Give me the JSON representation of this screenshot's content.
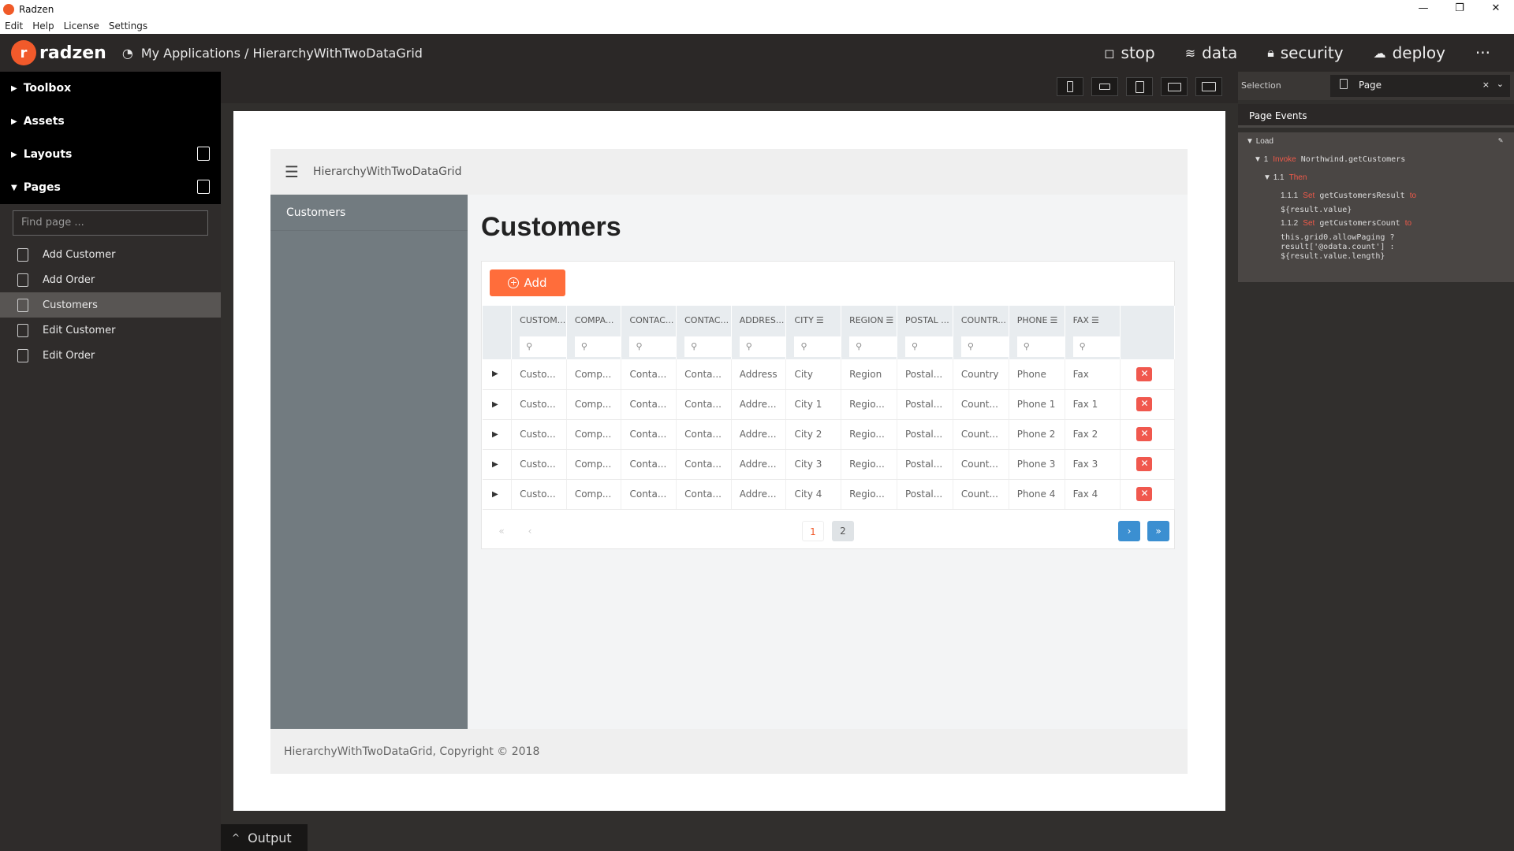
{
  "window": {
    "title": "Radzen",
    "min": "—",
    "max": "❐",
    "close": "✕"
  },
  "menu": [
    "Edit",
    "Help",
    "License",
    "Settings"
  ],
  "appbar": {
    "brand": "radzen",
    "breadcrumb": "My Applications / HierarchyWithTwoDataGrid",
    "nav": [
      {
        "label": "stop",
        "icon": "stop-icon"
      },
      {
        "label": "data",
        "icon": "layers-icon"
      },
      {
        "label": "security",
        "icon": "lock-icon"
      },
      {
        "label": "deploy",
        "icon": "cloud-upload-icon"
      }
    ],
    "more": "···"
  },
  "sidebar": {
    "sections": [
      {
        "label": "Toolbox",
        "expanded": false
      },
      {
        "label": "Assets",
        "expanded": false
      },
      {
        "label": "Layouts",
        "expanded": false
      },
      {
        "label": "Pages",
        "expanded": true
      }
    ],
    "find_placeholder": "Find page ...",
    "pages": [
      "Add Customer",
      "Add Order",
      "Customers",
      "Edit Customer",
      "Edit Order"
    ],
    "selected_page": "Customers"
  },
  "preview": {
    "header_title": "HierarchyWithTwoDataGrid",
    "nav_items": [
      "Customers"
    ],
    "page_title": "Customers",
    "add_label": "Add",
    "footer": "HierarchyWithTwoDataGrid, Copyright © 2018",
    "columns": [
      "CUSTOM...",
      "COMPA...",
      "CONTAC...",
      "CONTAC...",
      "ADDRES...",
      "CITY",
      "REGION",
      "POSTAL ...",
      "COUNTR...",
      "PHONE",
      "FAX"
    ],
    "rows": [
      [
        "Custo...",
        "Comp...",
        "Conta...",
        "Conta...",
        "Address",
        "City",
        "Region",
        "Postal...",
        "Country",
        "Phone",
        "Fax"
      ],
      [
        "Custo...",
        "Comp...",
        "Conta...",
        "Conta...",
        "Addre...",
        "City 1",
        "Regio...",
        "Postal...",
        "Count...",
        "Phone 1",
        "Fax 1"
      ],
      [
        "Custo...",
        "Comp...",
        "Conta...",
        "Conta...",
        "Addre...",
        "City 2",
        "Regio...",
        "Postal...",
        "Count...",
        "Phone 2",
        "Fax 2"
      ],
      [
        "Custo...",
        "Comp...",
        "Conta...",
        "Conta...",
        "Addre...",
        "City 3",
        "Regio...",
        "Postal...",
        "Count...",
        "Phone 3",
        "Fax 3"
      ],
      [
        "Custo...",
        "Comp...",
        "Conta...",
        "Conta...",
        "Addre...",
        "City 4",
        "Regio...",
        "Postal...",
        "Count...",
        "Phone 4",
        "Fax 4"
      ]
    ],
    "pager": {
      "pages": [
        "1",
        "2"
      ],
      "current": "1"
    }
  },
  "right_panel": {
    "selection_label": "Selection",
    "selection_value": "Page",
    "events_title": "Page Events",
    "event": "Load",
    "lines": {
      "l1_num": "1",
      "l1_kw": "Invoke",
      "l1_text": "Northwind.getCustomers",
      "l2_num": "1.1",
      "l2_kw": "Then",
      "l3_num": "1.1.1",
      "l3_kw": "Set",
      "l3_text": "getCustomersResult",
      "l3_to": "to",
      "l3_val": "${result.value}",
      "l4_num": "1.1.2",
      "l4_kw": "Set",
      "l4_text": "getCustomersCount",
      "l4_to": "to",
      "l4_val1": "this.grid0.allowPaging ?",
      "l4_val2": "result['@odata.count'] :",
      "l4_val3": "${result.value.length}"
    }
  },
  "output_tab": "Output",
  "colors": {
    "accent": "#f15a2b",
    "add_button": "#ff6d3b",
    "delete": "#f0584e",
    "pager_next": "#3b8fd1"
  }
}
